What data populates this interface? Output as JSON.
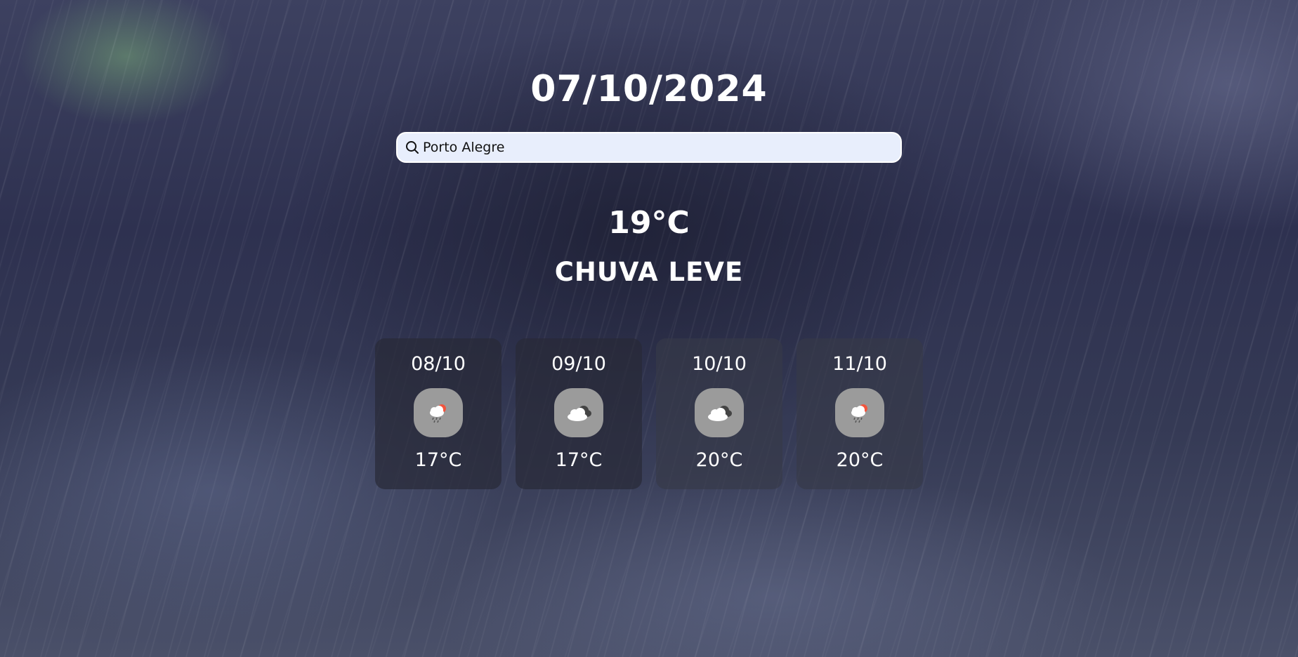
{
  "header": {
    "date": "07/10/2024"
  },
  "search": {
    "value": "Porto Alegre",
    "icon": "search-icon"
  },
  "current": {
    "temperature": "19°C",
    "condition": "CHUVA LEVE"
  },
  "forecast": [
    {
      "date": "08/10",
      "icon": "sun-cloud-rain-icon",
      "temperature": "17°C"
    },
    {
      "date": "09/10",
      "icon": "cloudy-icon",
      "temperature": "17°C"
    },
    {
      "date": "10/10",
      "icon": "cloudy-icon",
      "temperature": "20°C"
    },
    {
      "date": "11/10",
      "icon": "sun-cloud-rain-icon",
      "temperature": "20°C"
    }
  ],
  "colors": {
    "search_background": "#e8eefc",
    "icon_badge": "#9b9b9b",
    "text": "#ffffff"
  }
}
